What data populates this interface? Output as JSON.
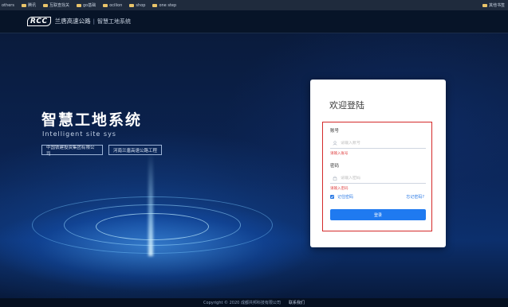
{
  "bookmarks": {
    "items": [
      {
        "label": "others"
      },
      {
        "label": "腾讯"
      },
      {
        "label": "互联查找关"
      },
      {
        "label": "go基础"
      },
      {
        "label": "ocilion"
      },
      {
        "label": "shop"
      },
      {
        "label": "one step"
      }
    ],
    "right_item": "其他书签"
  },
  "header": {
    "logo_mark": "RCC",
    "company": "兰唐高速公路",
    "separator": "|",
    "system_name": "智慧工地系统"
  },
  "hero": {
    "title_cn": "智慧工地系统",
    "title_en": "Intelligent site sys",
    "tags": [
      "中国铁建投资集团有限公司",
      "河南兰唐高速公路工程"
    ]
  },
  "login": {
    "title": "欢迎登陆",
    "username_label": "账号",
    "username_placeholder": "请输入账号",
    "username_error": "请输入账号",
    "password_label": "密码",
    "password_placeholder": "请输入密码",
    "password_error": "请输入密码",
    "remember_label": "记住密码",
    "remember_checked": true,
    "forgot_label": "忘记密码?",
    "submit_label": "登录"
  },
  "footer": {
    "copyright": "Copyright © 2020 成都共邦科技有限公司",
    "contact": "联系我们"
  },
  "colors": {
    "accent": "#1f7af0",
    "error": "#e04848",
    "highlight_box": "#d42a2a"
  }
}
